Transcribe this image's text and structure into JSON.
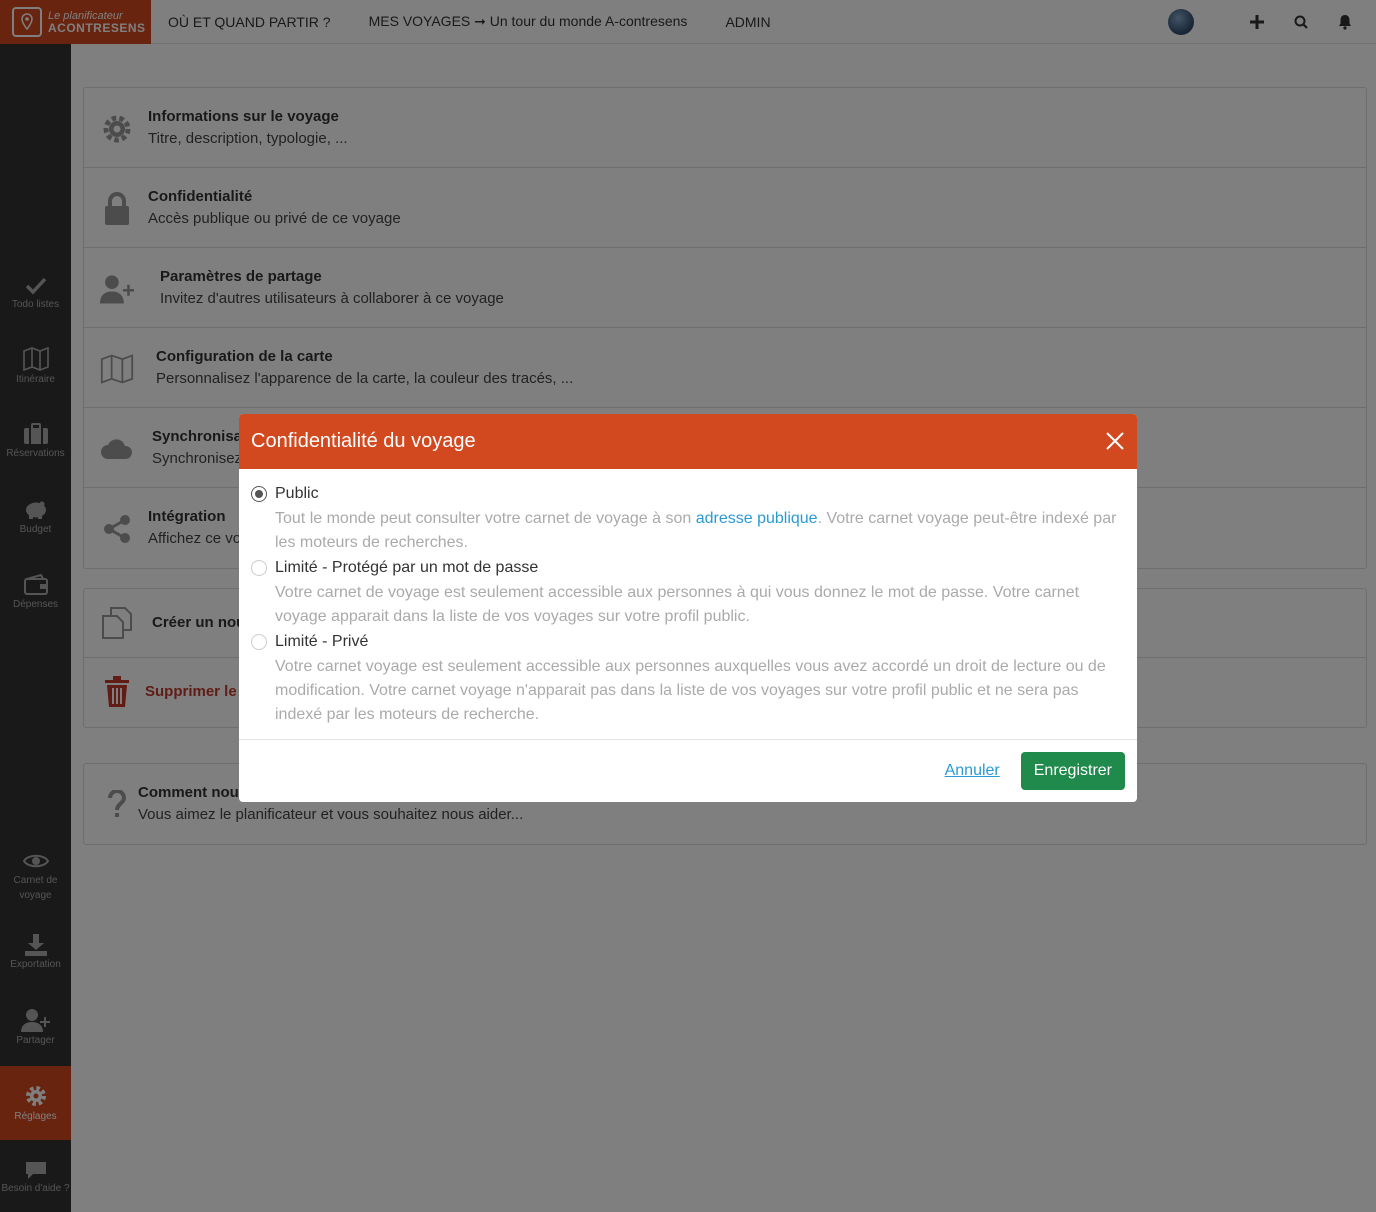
{
  "app": {
    "logo_line1": "Le planificateur",
    "logo_line2": "ACONTRESENS"
  },
  "nav": {
    "where_when": "OÙ ET QUAND PARTIR ?",
    "my_trips": "MES VOYAGES ➞ Un tour du monde A-contresens",
    "admin": "ADMIN"
  },
  "sidebar": {
    "items": [
      {
        "label": "Todo listes"
      },
      {
        "label": "Itinéraire"
      },
      {
        "label": "Réservations"
      },
      {
        "label": "Budget"
      },
      {
        "label": "Dépenses"
      },
      {
        "label": "Carnet de voyage"
      },
      {
        "label": "Exportation"
      },
      {
        "label": "Partager"
      },
      {
        "label": "Réglages"
      },
      {
        "label": "Besoin d'aide ?"
      }
    ]
  },
  "settings": {
    "rows": [
      {
        "title": "Informations sur le voyage",
        "subtitle": "Titre, description, typologie, ..."
      },
      {
        "title": "Confidentialité",
        "subtitle": "Accès publique ou privé de ce voyage"
      },
      {
        "title": "Paramètres de partage",
        "subtitle": "Invitez d'autres utilisateurs à collaborer à ce voyage"
      },
      {
        "title": "Configuration de la carte",
        "subtitle": "Personnalisez l'apparence de la carte, la couleur des tracés, ..."
      },
      {
        "title": "Synchronisat",
        "subtitle": "Synchronisez"
      },
      {
        "title": "Intégration",
        "subtitle": "Affichez ce vo"
      }
    ],
    "actions": [
      {
        "title": "Créer un nou"
      },
      {
        "title": "Supprimer le"
      }
    ],
    "help": {
      "title": "Comment nous",
      "subtitle": "Vous aimez le planificateur et vous souhaitez nous aider..."
    }
  },
  "modal": {
    "title": "Confidentialité du voyage",
    "options": [
      {
        "label": "Public",
        "checked": true,
        "desc_before": "Tout le monde peut consulter votre carnet de voyage à son ",
        "desc_link": "adresse publique",
        "desc_after": ". Votre carnet voyage peut-être indexé par les moteurs de recherches."
      },
      {
        "label": "Limité - Protégé par un mot de passe",
        "checked": false,
        "desc": "Votre carnet de voyage est seulement accessible aux personnes à qui vous donnez le mot de passe. Votre carnet voyage apparait dans la liste de vos voyages sur votre profil public."
      },
      {
        "label": "Limité - Privé",
        "checked": false,
        "desc": "Votre carnet voyage est seulement accessible aux personnes auxquelles vous avez accordé un droit de lecture ou de modification. Votre carnet voyage n'apparait pas dans la liste de vos voyages sur votre profil public et ne sera pas indexé par les moteurs de recherche."
      }
    ],
    "cancel_label": "Annuler",
    "save_label": "Enregistrer"
  },
  "colors": {
    "brand": "#d2481f",
    "sidebar": "#333333",
    "save": "#1f8a4c",
    "link": "#2b9ad4",
    "danger": "#c0392b"
  }
}
